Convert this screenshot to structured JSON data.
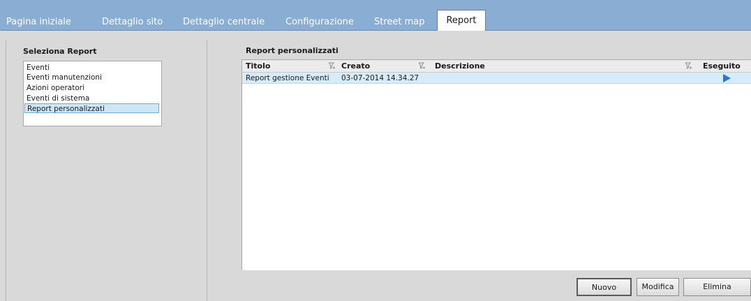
{
  "tabs": [
    {
      "label": "Pagina iniziale"
    },
    {
      "label": "Dettaglio sito"
    },
    {
      "label": "Dettaglio centrale"
    },
    {
      "label": "Configurazione"
    },
    {
      "label": "Street map"
    },
    {
      "label": "Report",
      "active": true
    }
  ],
  "left": {
    "title": "Seleziona Report",
    "items": [
      {
        "label": "Eventi"
      },
      {
        "label": "Eventi manutenzioni"
      },
      {
        "label": "Azioni operatori"
      },
      {
        "label": "Eventi di sistema"
      },
      {
        "label": "Report personalizzati",
        "selected": true
      }
    ]
  },
  "main": {
    "title": "Report personalizzati",
    "columns": {
      "title": "Titolo",
      "created": "Creato",
      "description": "Descrizione",
      "executed": "Eseguito"
    },
    "rows": [
      {
        "title": "Report gestione Eventi",
        "created": "03-07-2014 14.34.27",
        "description": "",
        "executed_icon": "play-icon"
      }
    ]
  },
  "buttons": {
    "new_label": "Nuovo",
    "edit_label": "Modifica",
    "delete_label": "Elimina"
  },
  "colors": {
    "tabbar": "#8aaed3",
    "selection": "#cfe6f5",
    "play": "#2f74c8"
  },
  "icons": {
    "filter": "filter-icon",
    "play": "play-icon"
  }
}
